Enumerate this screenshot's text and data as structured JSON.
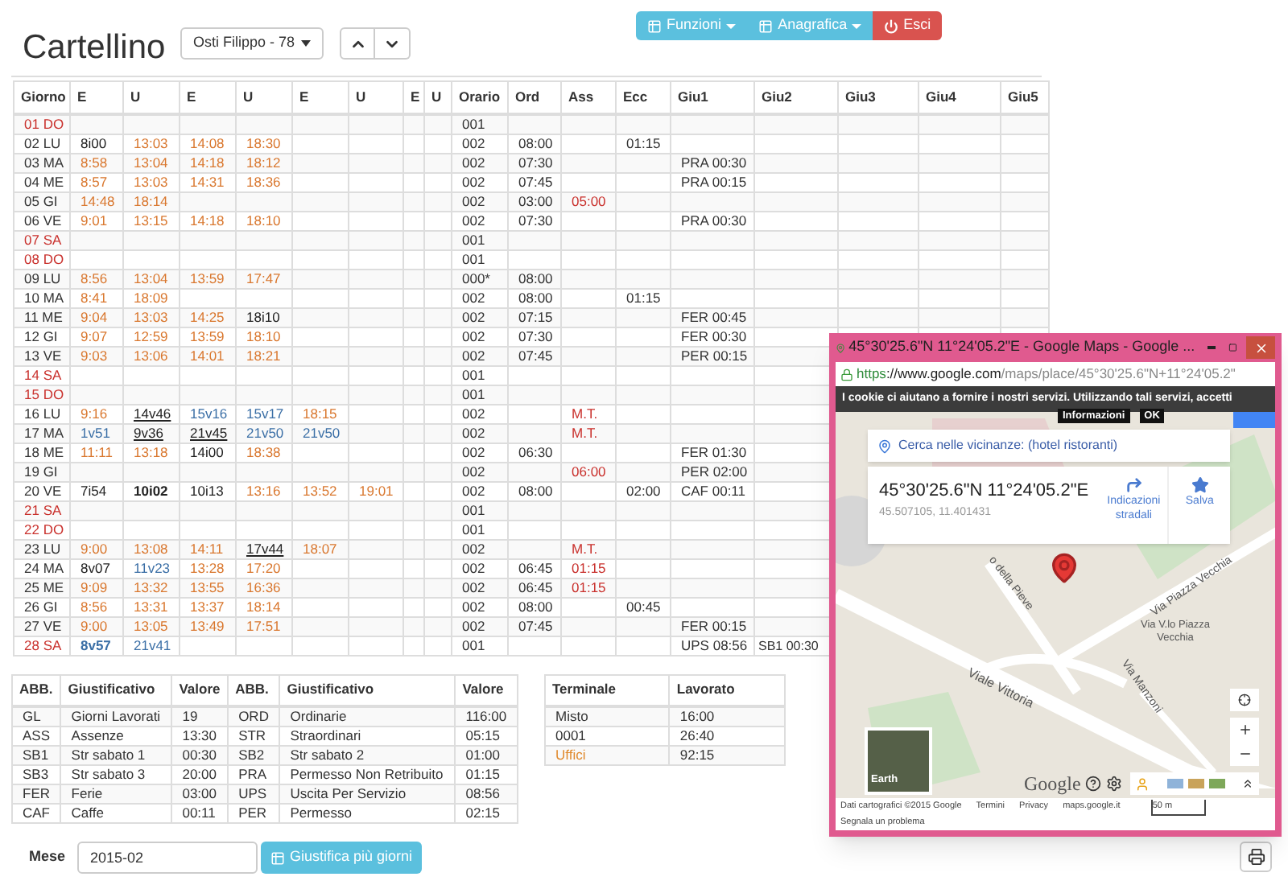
{
  "title": "Cartellino",
  "employee_select": {
    "value": "Osti Filippo - 78"
  },
  "nav_buttons": [
    {
      "label": "Funzioni",
      "kind": "menu"
    },
    {
      "label": "Anagrafica",
      "kind": "menu"
    },
    {
      "label": "Esci",
      "kind": "danger"
    }
  ],
  "timesheet": {
    "columns": [
      "Giorno",
      "E",
      "U",
      "E",
      "U",
      "E",
      "U",
      "E",
      "U",
      "Orario",
      "Ord",
      "Ass",
      "Ecc",
      "Giu1",
      "Giu2",
      "Giu3",
      "Giu4",
      "Giu5"
    ],
    "rows": [
      {
        "day": "01 DO",
        "holiday": true,
        "punches": [],
        "orario": "001"
      },
      {
        "day": "02 LU",
        "holiday": false,
        "punches": [
          {
            "t": "8i00",
            "kind": "manual"
          },
          {
            "t": "13:03",
            "kind": "time"
          },
          {
            "t": "14:08",
            "kind": "time"
          },
          {
            "t": "18:30",
            "kind": "time"
          }
        ],
        "orario": "002",
        "ord": "08:00",
        "ecc": "01:15"
      },
      {
        "day": "03 MA",
        "holiday": false,
        "punches": [
          {
            "t": "8:58",
            "kind": "time"
          },
          {
            "t": "13:04",
            "kind": "time"
          },
          {
            "t": "14:18",
            "kind": "time"
          },
          {
            "t": "18:12",
            "kind": "time"
          }
        ],
        "orario": "002",
        "ord": "07:30",
        "giu1": "PRA 00:30"
      },
      {
        "day": "04 ME",
        "holiday": false,
        "punches": [
          {
            "t": "8:57",
            "kind": "time"
          },
          {
            "t": "13:03",
            "kind": "time"
          },
          {
            "t": "14:31",
            "kind": "time"
          },
          {
            "t": "18:36",
            "kind": "time"
          }
        ],
        "orario": "002",
        "ord": "07:45",
        "giu1": "PRA 00:15"
      },
      {
        "day": "05 GI",
        "holiday": false,
        "punches": [
          {
            "t": "14:48",
            "kind": "time"
          },
          {
            "t": "18:14",
            "kind": "time"
          }
        ],
        "orario": "002",
        "ord": "03:00",
        "ass": "05:00"
      },
      {
        "day": "06 VE",
        "holiday": false,
        "punches": [
          {
            "t": "9:01",
            "kind": "time"
          },
          {
            "t": "13:15",
            "kind": "time"
          },
          {
            "t": "14:18",
            "kind": "time"
          },
          {
            "t": "18:10",
            "kind": "time"
          }
        ],
        "orario": "002",
        "ord": "07:30",
        "giu1": "PRA 00:30"
      },
      {
        "day": "07 SA",
        "holiday": true,
        "punches": [],
        "orario": "001"
      },
      {
        "day": "08 DO",
        "holiday": true,
        "punches": [],
        "orario": "001"
      },
      {
        "day": "09 LU",
        "holiday": false,
        "punches": [
          {
            "t": "8:56",
            "kind": "time"
          },
          {
            "t": "13:04",
            "kind": "time"
          },
          {
            "t": "13:59",
            "kind": "time"
          },
          {
            "t": "17:47",
            "kind": "time"
          }
        ],
        "orario": "000*",
        "ord": "08:00"
      },
      {
        "day": "10 MA",
        "holiday": false,
        "punches": [
          {
            "t": "8:41",
            "kind": "time"
          },
          {
            "t": "18:09",
            "kind": "time"
          }
        ],
        "orario": "002",
        "ord": "08:00",
        "ecc": "01:15"
      },
      {
        "day": "11 ME",
        "holiday": false,
        "punches": [
          {
            "t": "9:04",
            "kind": "time"
          },
          {
            "t": "13:03",
            "kind": "time"
          },
          {
            "t": "14:25",
            "kind": "time"
          },
          {
            "t": "18i10",
            "kind": "manual"
          }
        ],
        "orario": "002",
        "ord": "07:15",
        "giu1": "FER 00:45"
      },
      {
        "day": "12 GI",
        "holiday": false,
        "punches": [
          {
            "t": "9:07",
            "kind": "time"
          },
          {
            "t": "12:59",
            "kind": "time"
          },
          {
            "t": "13:59",
            "kind": "time"
          },
          {
            "t": "18:10",
            "kind": "time"
          }
        ],
        "orario": "002",
        "ord": "07:30",
        "giu1": "FER 00:30"
      },
      {
        "day": "13 VE",
        "holiday": false,
        "punches": [
          {
            "t": "9:03",
            "kind": "time"
          },
          {
            "t": "13:06",
            "kind": "time"
          },
          {
            "t": "14:01",
            "kind": "time"
          },
          {
            "t": "18:21",
            "kind": "time"
          }
        ],
        "orario": "002",
        "ord": "07:45",
        "giu1": "PER 00:15"
      },
      {
        "day": "14 SA",
        "holiday": true,
        "punches": [],
        "orario": "001"
      },
      {
        "day": "15 DO",
        "holiday": true,
        "punches": [],
        "orario": "001"
      },
      {
        "day": "16 LU",
        "holiday": false,
        "punches": [
          {
            "t": "9:16",
            "kind": "time"
          },
          {
            "t": "14v46",
            "kind": "manual",
            "underline": true
          },
          {
            "t": "15v16",
            "kind": "remote"
          },
          {
            "t": "15v17",
            "kind": "remote"
          },
          {
            "t": "18:15",
            "kind": "time"
          }
        ],
        "orario": "002",
        "ass": "M.T."
      },
      {
        "day": "17 MA",
        "holiday": false,
        "punches": [
          {
            "t": "1v51",
            "kind": "remote"
          },
          {
            "t": "9v36",
            "kind": "manual",
            "underline": true
          },
          {
            "t": "21v45",
            "kind": "manual",
            "underline": true
          },
          {
            "t": "21v50",
            "kind": "remote"
          },
          {
            "t": "21v50",
            "kind": "remote"
          }
        ],
        "orario": "002",
        "ass": "M.T."
      },
      {
        "day": "18 ME",
        "holiday": false,
        "punches": [
          {
            "t": "11:11",
            "kind": "time"
          },
          {
            "t": "13:18",
            "kind": "time"
          },
          {
            "t": "14i00",
            "kind": "manual"
          },
          {
            "t": "18:38",
            "kind": "time"
          }
        ],
        "orario": "002",
        "ord": "06:30",
        "giu1": "FER 01:30"
      },
      {
        "day": "19 GI",
        "holiday": false,
        "punches": [],
        "orario": "002",
        "ass": "06:00",
        "giu1": "PER 02:00"
      },
      {
        "day": "20 VE",
        "holiday": false,
        "punches": [
          {
            "t": "7i54",
            "kind": "manual"
          },
          {
            "t": "10i02",
            "kind": "manual",
            "bold": true
          },
          {
            "t": "10i13",
            "kind": "manual"
          },
          {
            "t": "13:16",
            "kind": "time"
          },
          {
            "t": "13:52",
            "kind": "time"
          },
          {
            "t": "19:01",
            "kind": "time"
          }
        ],
        "orario": "002",
        "ord": "08:00",
        "ecc": "02:00",
        "giu1": "CAF 00:11"
      },
      {
        "day": "21 SA",
        "holiday": true,
        "punches": [],
        "orario": "001"
      },
      {
        "day": "22 DO",
        "holiday": true,
        "punches": [],
        "orario": "001"
      },
      {
        "day": "23 LU",
        "holiday": false,
        "punches": [
          {
            "t": "9:00",
            "kind": "time"
          },
          {
            "t": "13:08",
            "kind": "time"
          },
          {
            "t": "14:11",
            "kind": "time"
          },
          {
            "t": "17v44",
            "kind": "manual",
            "underline": true
          },
          {
            "t": "18:07",
            "kind": "time"
          }
        ],
        "orario": "002",
        "ass": "M.T."
      },
      {
        "day": "24 MA",
        "holiday": false,
        "punches": [
          {
            "t": "8v07",
            "kind": "manual"
          },
          {
            "t": "11v23",
            "kind": "remote"
          },
          {
            "t": "13:28",
            "kind": "time"
          },
          {
            "t": "17:20",
            "kind": "time"
          }
        ],
        "orario": "002",
        "ord": "06:45",
        "ass": "01:15"
      },
      {
        "day": "25 ME",
        "holiday": false,
        "punches": [
          {
            "t": "9:09",
            "kind": "time"
          },
          {
            "t": "13:32",
            "kind": "time"
          },
          {
            "t": "13:55",
            "kind": "time"
          },
          {
            "t": "16:36",
            "kind": "time"
          }
        ],
        "orario": "002",
        "ord": "06:45",
        "ass": "01:15"
      },
      {
        "day": "26 GI",
        "holiday": false,
        "punches": [
          {
            "t": "8:56",
            "kind": "time"
          },
          {
            "t": "13:31",
            "kind": "time"
          },
          {
            "t": "13:37",
            "kind": "time"
          },
          {
            "t": "18:14",
            "kind": "time"
          }
        ],
        "orario": "002",
        "ord": "08:00",
        "ecc": "00:45"
      },
      {
        "day": "27 VE",
        "holiday": false,
        "punches": [
          {
            "t": "9:00",
            "kind": "time"
          },
          {
            "t": "13:05",
            "kind": "time"
          },
          {
            "t": "13:49",
            "kind": "time"
          },
          {
            "t": "17:51",
            "kind": "time"
          }
        ],
        "orario": "002",
        "ord": "07:45",
        "giu1": "FER 00:15"
      },
      {
        "day": "28 SA",
        "holiday": true,
        "punches": [
          {
            "t": "8v57",
            "kind": "remote",
            "bold": true
          },
          {
            "t": "21v41",
            "kind": "remote"
          }
        ],
        "orario": "001",
        "giu1": "UPS 08:56",
        "giu2": "SB1 00:30"
      }
    ]
  },
  "summary": {
    "columns": [
      "ABB.",
      "Giustificativo",
      "Valore",
      "ABB.",
      "Giustificativo",
      "Valore"
    ],
    "rows": [
      [
        "GL",
        "Giorni Lavorati",
        "19",
        "ORD",
        "Ordinarie",
        "116:00"
      ],
      [
        "ASS",
        "Assenze",
        "13:30",
        "STR",
        "Straordinari",
        "05:15"
      ],
      [
        "SB1",
        "Str sabato 1",
        "00:30",
        "SB2",
        "Str sabato 2",
        "01:00"
      ],
      [
        "SB3",
        "Str sabato 3",
        "20:00",
        "PRA",
        "Permesso Non Retribuito",
        "01:15"
      ],
      [
        "FER",
        "Ferie",
        "03:00",
        "UPS",
        "Uscita Per Servizio",
        "08:56"
      ],
      [
        "CAF",
        "Caffe",
        "00:11",
        "PER",
        "Permesso",
        "02:15"
      ]
    ]
  },
  "terminals": {
    "columns": [
      "Terminale",
      "Lavorato"
    ],
    "rows": [
      {
        "cells": [
          "Misto",
          "16:00"
        ],
        "highlight": false
      },
      {
        "cells": [
          "0001",
          "26:40"
        ],
        "highlight": false
      },
      {
        "cells": [
          "Uffici",
          "92:15"
        ],
        "highlight": true
      }
    ]
  },
  "month": {
    "label": "Mese",
    "value": "2015-02",
    "button": "Giustifica più giorni"
  },
  "maps_window": {
    "title": "45°30'25.6\"N 11°24'05.2\"E - Google Maps - Google ...",
    "url_scheme": "https",
    "url_host": "://www.google.com",
    "url_path": "/maps/place/45°30'25.6\"N+11°24'05.2\"",
    "cookie_notice": "I cookie ci aiutano a fornire i nostri servizi. Utilizzando tali servizi, accetti",
    "cookie_buttons": [
      "Informazioni",
      "OK"
    ],
    "nearby": "Cerca nelle vicinanze: (hotel ristoranti)",
    "place_title": "45°30'25.6\"N 11°24'05.2\"E",
    "place_coords": "45.507105, 11.401431",
    "actions": [
      "Indicazioni stradali",
      "Salva"
    ],
    "street_labels": [
      "o della Pieve",
      "Via Piazza Vecchia",
      "Via V.lo Piazza Vecchia",
      "Viale Vittoria",
      "Via Manzoni"
    ],
    "earth_label": "Earth",
    "logo": "Google",
    "footer": [
      "Dati cartografici ©2015 Google",
      "Termini",
      "Privacy",
      "maps.google.it",
      "50 m"
    ],
    "report": "Segnala un problema"
  }
}
